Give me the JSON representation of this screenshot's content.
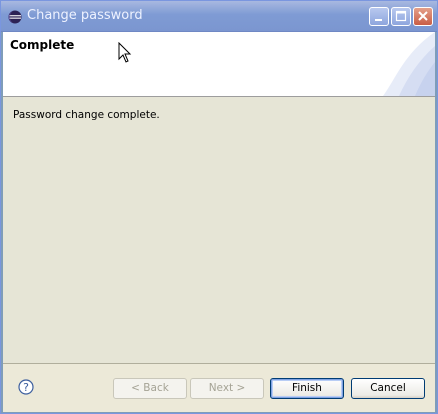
{
  "window": {
    "title": "Change password"
  },
  "header": {
    "title": "Complete"
  },
  "content": {
    "message": "Password change complete."
  },
  "footer": {
    "back_label": "< Back",
    "next_label": "Next >",
    "finish_label": "Finish",
    "cancel_label": "Cancel"
  },
  "icons": {
    "app": "eclipse-icon",
    "help": "help-icon",
    "minimize": "minimize-icon",
    "maximize": "maximize-icon",
    "close": "close-icon"
  },
  "colors": {
    "titlebar": "#7f9bd4",
    "dialog_bg": "#ece9d8",
    "content_bg": "#e6e5d6",
    "close_button": "#c95d45"
  }
}
